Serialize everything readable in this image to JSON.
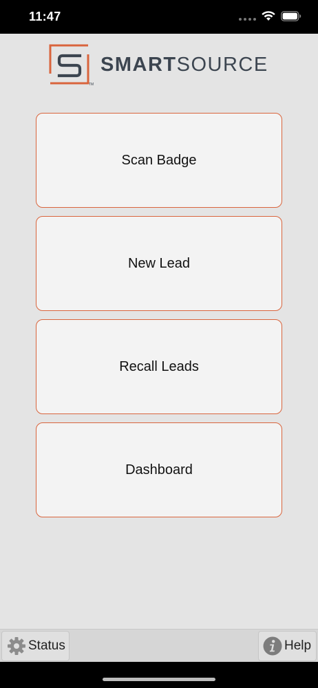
{
  "status_bar": {
    "time": "11:47",
    "icons": [
      "signal-dots-icon",
      "wifi-icon",
      "battery-icon"
    ]
  },
  "logo": {
    "text_bold": "SMART",
    "text_light": "SOURCE",
    "trademark": "TM",
    "colors": {
      "accent": "#d9643c",
      "text": "#3c4550"
    }
  },
  "menu": {
    "buttons": [
      {
        "label": "Scan Badge"
      },
      {
        "label": "New Lead"
      },
      {
        "label": "Recall Leads"
      },
      {
        "label": "Dashboard"
      }
    ]
  },
  "toolbar": {
    "status_label": "Status",
    "status_icon": "gear-icon",
    "help_label": "Help",
    "help_icon": "info-icon"
  },
  "colors": {
    "background": "#e4e4e4",
    "button_border": "#d9643c",
    "button_fill": "#f3f3f3"
  }
}
